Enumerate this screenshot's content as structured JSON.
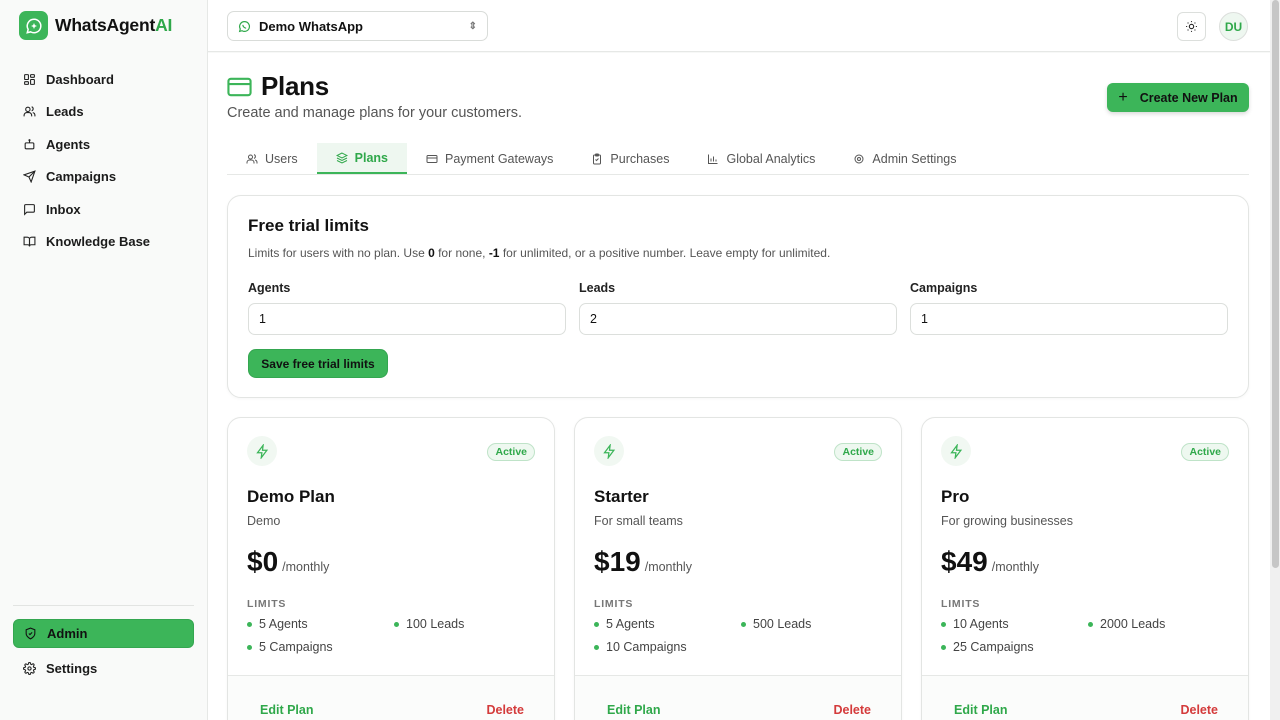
{
  "brand": {
    "name_main": "WhatsAgent",
    "name_accent": "AI"
  },
  "sidebar": {
    "items": [
      {
        "label": "Dashboard",
        "icon": "grid-icon"
      },
      {
        "label": "Leads",
        "icon": "users-icon"
      },
      {
        "label": "Agents",
        "icon": "bot-icon"
      },
      {
        "label": "Campaigns",
        "icon": "send-icon"
      },
      {
        "label": "Inbox",
        "icon": "message-icon"
      },
      {
        "label": "Knowledge Base",
        "icon": "book-icon"
      }
    ],
    "bottom": [
      {
        "label": "Admin",
        "icon": "shield-icon",
        "active": true
      },
      {
        "label": "Settings",
        "icon": "gear-icon"
      }
    ]
  },
  "topbar": {
    "workspace": "Demo WhatsApp",
    "avatar_initials": "DU"
  },
  "page": {
    "title": "Plans",
    "subtitle": "Create and manage plans for your customers.",
    "create_button": "Create New Plan"
  },
  "tabs": [
    {
      "label": "Users",
      "icon": "users-icon"
    },
    {
      "label": "Plans",
      "icon": "layers-icon",
      "active": true
    },
    {
      "label": "Payment Gateways",
      "icon": "card-icon"
    },
    {
      "label": "Purchases",
      "icon": "clipboard-icon"
    },
    {
      "label": "Global Analytics",
      "icon": "chart-icon"
    },
    {
      "label": "Admin Settings",
      "icon": "gear-icon"
    }
  ],
  "trial": {
    "title": "Free trial limits",
    "desc_1": "Limits for users with no plan. Use ",
    "desc_zero": "0",
    "desc_2": " for none, ",
    "desc_neg": "-1",
    "desc_3": " for unlimited, or a positive number. Leave empty for unlimited.",
    "fields": [
      {
        "label": "Agents",
        "value": "1"
      },
      {
        "label": "Leads",
        "value": "2"
      },
      {
        "label": "Campaigns",
        "value": "1"
      }
    ],
    "save_label": "Save free trial limits"
  },
  "plans": [
    {
      "name": "Demo Plan",
      "desc": "Demo",
      "price": "$0",
      "period": "/monthly",
      "badge": "Active",
      "limits_label": "LIMITS",
      "limits": [
        "5 Agents",
        "100 Leads",
        "5 Campaigns"
      ],
      "edit": "Edit Plan",
      "delete": "Delete"
    },
    {
      "name": "Starter",
      "desc": "For small teams",
      "price": "$19",
      "period": "/monthly",
      "badge": "Active",
      "limits_label": "LIMITS",
      "limits": [
        "5 Agents",
        "500 Leads",
        "10 Campaigns"
      ],
      "edit": "Edit Plan",
      "delete": "Delete"
    },
    {
      "name": "Pro",
      "desc": "For growing businesses",
      "price": "$49",
      "period": "/monthly",
      "badge": "Active",
      "limits_label": "LIMITS",
      "limits": [
        "10 Agents",
        "2000 Leads",
        "25 Campaigns"
      ],
      "edit": "Edit Plan",
      "delete": "Delete"
    }
  ],
  "colors": {
    "accent": "#3cb559",
    "danger": "#d43b3b"
  }
}
